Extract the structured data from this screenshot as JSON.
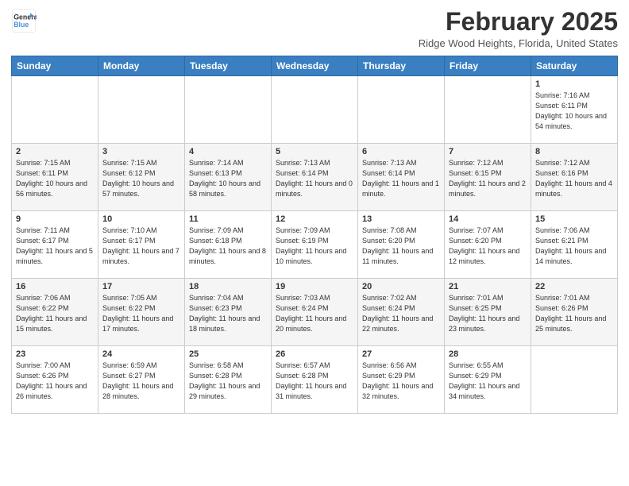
{
  "header": {
    "logo_line1": "General",
    "logo_line2": "Blue",
    "month": "February 2025",
    "location": "Ridge Wood Heights, Florida, United States"
  },
  "weekdays": [
    "Sunday",
    "Monday",
    "Tuesday",
    "Wednesday",
    "Thursday",
    "Friday",
    "Saturday"
  ],
  "weeks": [
    [
      {
        "day": "",
        "info": ""
      },
      {
        "day": "",
        "info": ""
      },
      {
        "day": "",
        "info": ""
      },
      {
        "day": "",
        "info": ""
      },
      {
        "day": "",
        "info": ""
      },
      {
        "day": "",
        "info": ""
      },
      {
        "day": "1",
        "info": "Sunrise: 7:16 AM\nSunset: 6:11 PM\nDaylight: 10 hours and 54 minutes."
      }
    ],
    [
      {
        "day": "2",
        "info": "Sunrise: 7:15 AM\nSunset: 6:11 PM\nDaylight: 10 hours and 56 minutes."
      },
      {
        "day": "3",
        "info": "Sunrise: 7:15 AM\nSunset: 6:12 PM\nDaylight: 10 hours and 57 minutes."
      },
      {
        "day": "4",
        "info": "Sunrise: 7:14 AM\nSunset: 6:13 PM\nDaylight: 10 hours and 58 minutes."
      },
      {
        "day": "5",
        "info": "Sunrise: 7:13 AM\nSunset: 6:14 PM\nDaylight: 11 hours and 0 minutes."
      },
      {
        "day": "6",
        "info": "Sunrise: 7:13 AM\nSunset: 6:14 PM\nDaylight: 11 hours and 1 minute."
      },
      {
        "day": "7",
        "info": "Sunrise: 7:12 AM\nSunset: 6:15 PM\nDaylight: 11 hours and 2 minutes."
      },
      {
        "day": "8",
        "info": "Sunrise: 7:12 AM\nSunset: 6:16 PM\nDaylight: 11 hours and 4 minutes."
      }
    ],
    [
      {
        "day": "9",
        "info": "Sunrise: 7:11 AM\nSunset: 6:17 PM\nDaylight: 11 hours and 5 minutes."
      },
      {
        "day": "10",
        "info": "Sunrise: 7:10 AM\nSunset: 6:17 PM\nDaylight: 11 hours and 7 minutes."
      },
      {
        "day": "11",
        "info": "Sunrise: 7:09 AM\nSunset: 6:18 PM\nDaylight: 11 hours and 8 minutes."
      },
      {
        "day": "12",
        "info": "Sunrise: 7:09 AM\nSunset: 6:19 PM\nDaylight: 11 hours and 10 minutes."
      },
      {
        "day": "13",
        "info": "Sunrise: 7:08 AM\nSunset: 6:20 PM\nDaylight: 11 hours and 11 minutes."
      },
      {
        "day": "14",
        "info": "Sunrise: 7:07 AM\nSunset: 6:20 PM\nDaylight: 11 hours and 12 minutes."
      },
      {
        "day": "15",
        "info": "Sunrise: 7:06 AM\nSunset: 6:21 PM\nDaylight: 11 hours and 14 minutes."
      }
    ],
    [
      {
        "day": "16",
        "info": "Sunrise: 7:06 AM\nSunset: 6:22 PM\nDaylight: 11 hours and 15 minutes."
      },
      {
        "day": "17",
        "info": "Sunrise: 7:05 AM\nSunset: 6:22 PM\nDaylight: 11 hours and 17 minutes."
      },
      {
        "day": "18",
        "info": "Sunrise: 7:04 AM\nSunset: 6:23 PM\nDaylight: 11 hours and 18 minutes."
      },
      {
        "day": "19",
        "info": "Sunrise: 7:03 AM\nSunset: 6:24 PM\nDaylight: 11 hours and 20 minutes."
      },
      {
        "day": "20",
        "info": "Sunrise: 7:02 AM\nSunset: 6:24 PM\nDaylight: 11 hours and 22 minutes."
      },
      {
        "day": "21",
        "info": "Sunrise: 7:01 AM\nSunset: 6:25 PM\nDaylight: 11 hours and 23 minutes."
      },
      {
        "day": "22",
        "info": "Sunrise: 7:01 AM\nSunset: 6:26 PM\nDaylight: 11 hours and 25 minutes."
      }
    ],
    [
      {
        "day": "23",
        "info": "Sunrise: 7:00 AM\nSunset: 6:26 PM\nDaylight: 11 hours and 26 minutes."
      },
      {
        "day": "24",
        "info": "Sunrise: 6:59 AM\nSunset: 6:27 PM\nDaylight: 11 hours and 28 minutes."
      },
      {
        "day": "25",
        "info": "Sunrise: 6:58 AM\nSunset: 6:28 PM\nDaylight: 11 hours and 29 minutes."
      },
      {
        "day": "26",
        "info": "Sunrise: 6:57 AM\nSunset: 6:28 PM\nDaylight: 11 hours and 31 minutes."
      },
      {
        "day": "27",
        "info": "Sunrise: 6:56 AM\nSunset: 6:29 PM\nDaylight: 11 hours and 32 minutes."
      },
      {
        "day": "28",
        "info": "Sunrise: 6:55 AM\nSunset: 6:29 PM\nDaylight: 11 hours and 34 minutes."
      },
      {
        "day": "",
        "info": ""
      }
    ]
  ]
}
